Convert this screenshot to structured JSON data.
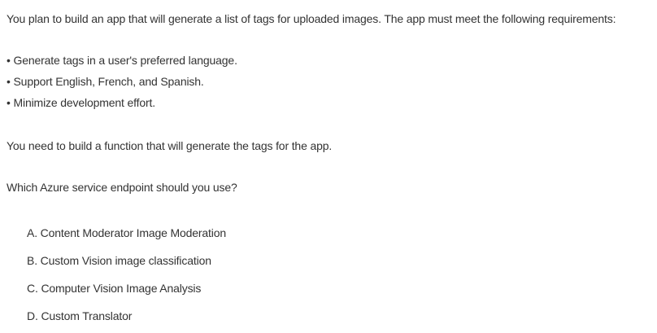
{
  "question": {
    "intro": "You plan to build an app that will generate a list of tags for uploaded images. The app must meet the following requirements:",
    "requirements": [
      "• Generate tags in a user's preferred language.",
      "• Support English, French, and Spanish.",
      "• Minimize development effort."
    ],
    "task": "You need to build a function that will generate the tags for the app.",
    "prompt": "Which Azure service endpoint should you use?"
  },
  "options": [
    "A. Content Moderator Image Moderation",
    "B. Custom Vision image classification",
    "C. Computer Vision Image Analysis",
    "D. Custom Translator"
  ]
}
